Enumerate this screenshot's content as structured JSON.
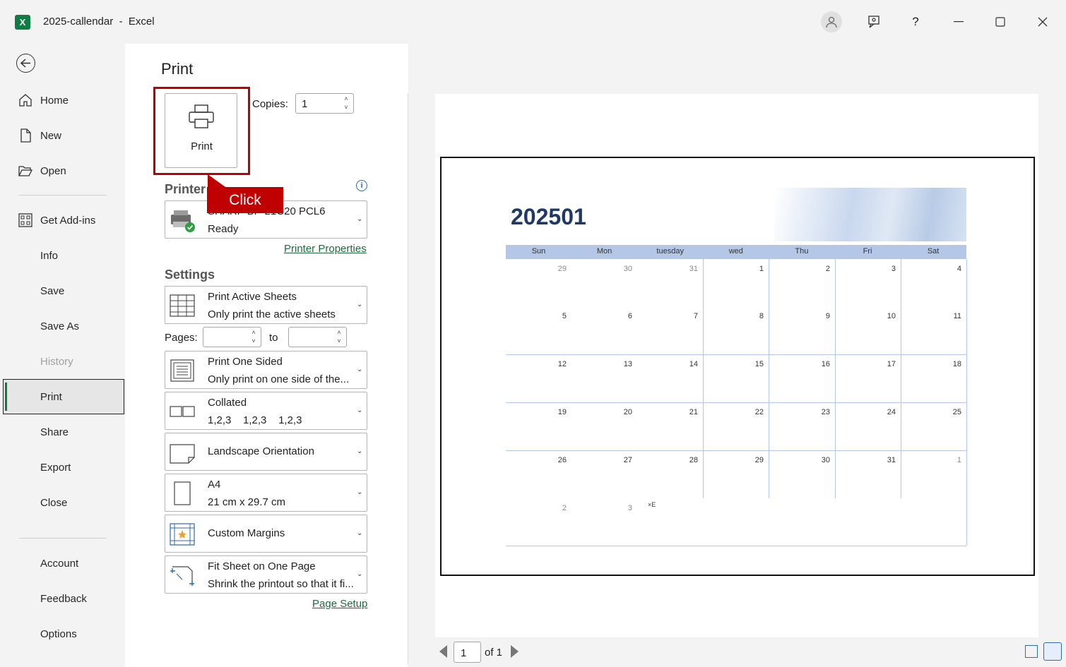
{
  "window": {
    "title": "2025-callendar  -  Excel",
    "app_icon": "excel-icon",
    "app_letter": "X",
    "controls": [
      "minimize-icon",
      "maximize-icon",
      "close-icon"
    ]
  },
  "nav": {
    "back_icon": "back-arrow-icon",
    "items": [
      {
        "label": "Home",
        "icon": "home-icon"
      },
      {
        "label": "New",
        "icon": "new-document-icon"
      },
      {
        "label": "Open",
        "icon": "folder-open-icon"
      },
      {
        "label": "Get Add-ins",
        "icon": "grid-icon"
      },
      {
        "label": "Info"
      },
      {
        "label": "Save"
      },
      {
        "label": "Save As"
      },
      {
        "label": "History",
        "disabled": true
      },
      {
        "label": "Print",
        "selected": true
      },
      {
        "label": "Share"
      },
      {
        "label": "Export"
      },
      {
        "label": "Close"
      },
      {
        "label": "Account"
      },
      {
        "label": "Feedback"
      },
      {
        "label": "Options"
      }
    ]
  },
  "print": {
    "title": "Print",
    "print_button_label": "Print",
    "copies_label": "Copies:",
    "copies_value": "1",
    "callout": "Click",
    "printer_section": "Printer",
    "printer_name": "SHARP BP-21C20 PCL6",
    "printer_status": "Ready",
    "printer_properties_link": "Printer Properties",
    "settings_section": "Settings",
    "settings": {
      "what": {
        "line1": "Print Active Sheets",
        "line2": "Only print the active sheets"
      },
      "pages_label": "Pages:",
      "to_label": "to",
      "sided": {
        "line1": "Print One Sided",
        "line2": "Only print on one side of the..."
      },
      "collate": {
        "line1": "Collated",
        "line2": "1,2,3    1,2,3    1,2,3"
      },
      "orientation": {
        "label": "Landscape Orientation"
      },
      "paper": {
        "line1": "A4",
        "line2": "21 cm x 29.7 cm"
      },
      "margins": {
        "label": "Custom Margins"
      },
      "scaling": {
        "line1": "Fit Sheet on One Page",
        "line2": "Shrink the printout so that it fi..."
      }
    },
    "page_setup_link": "Page Setup"
  },
  "preview": {
    "calendar_title": "202501",
    "weekdays": [
      "Sun",
      "Mon",
      "tuesday",
      "wed",
      "Thu",
      "Fri",
      "Sat"
    ],
    "weeks": [
      [
        "29",
        "30",
        "31",
        "1",
        "2",
        "3",
        "4"
      ],
      [
        "5",
        "6",
        "7",
        "8",
        "9",
        "10",
        "11"
      ],
      [
        "12",
        "13",
        "14",
        "15",
        "16",
        "17",
        "18"
      ],
      [
        "19",
        "20",
        "21",
        "22",
        "23",
        "24",
        "25"
      ],
      [
        "26",
        "27",
        "28",
        "29",
        "30",
        "31",
        "1"
      ],
      [
        "2",
        "3",
        "",
        "",
        "",
        "",
        ""
      ]
    ],
    "extra_mark": "×E",
    "page_current": "1",
    "page_of": "of 1"
  }
}
